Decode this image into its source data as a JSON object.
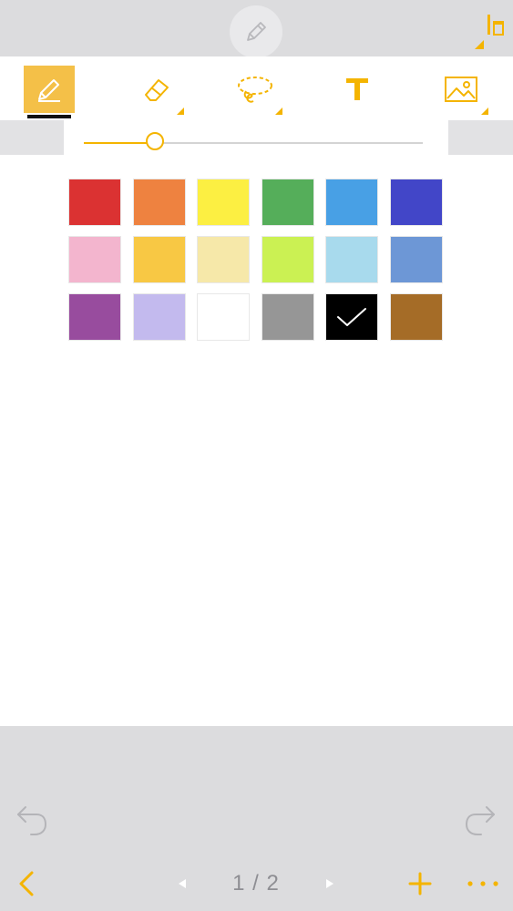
{
  "toolbar": {
    "tools": [
      {
        "name": "pen",
        "icon": "pencil-icon",
        "active": true
      },
      {
        "name": "eraser",
        "icon": "eraser-icon",
        "active": false
      },
      {
        "name": "lasso",
        "icon": "lasso-icon",
        "active": false
      },
      {
        "name": "text",
        "icon": "text-icon",
        "active": false
      },
      {
        "name": "image",
        "icon": "image-icon",
        "active": false
      }
    ]
  },
  "accent_color": "#F4B400",
  "pen_settings": {
    "size_slider_value": 0.21,
    "colors": [
      [
        "#DB3232",
        "#EE8240",
        "#FCEF42",
        "#55AE5A",
        "#48A0E5",
        "#4246C8"
      ],
      [
        "#F3B5CE",
        "#F8C844",
        "#F6E8A9",
        "#CBF153",
        "#A8DAED",
        "#6D97D6"
      ],
      [
        "#984C9E",
        "#C3BAEE",
        "#FFFFFF",
        "#969696",
        "#000000",
        "#A56C27"
      ]
    ],
    "selected_color": "#000000"
  },
  "navigation": {
    "page_indicator": "1 / 2"
  }
}
